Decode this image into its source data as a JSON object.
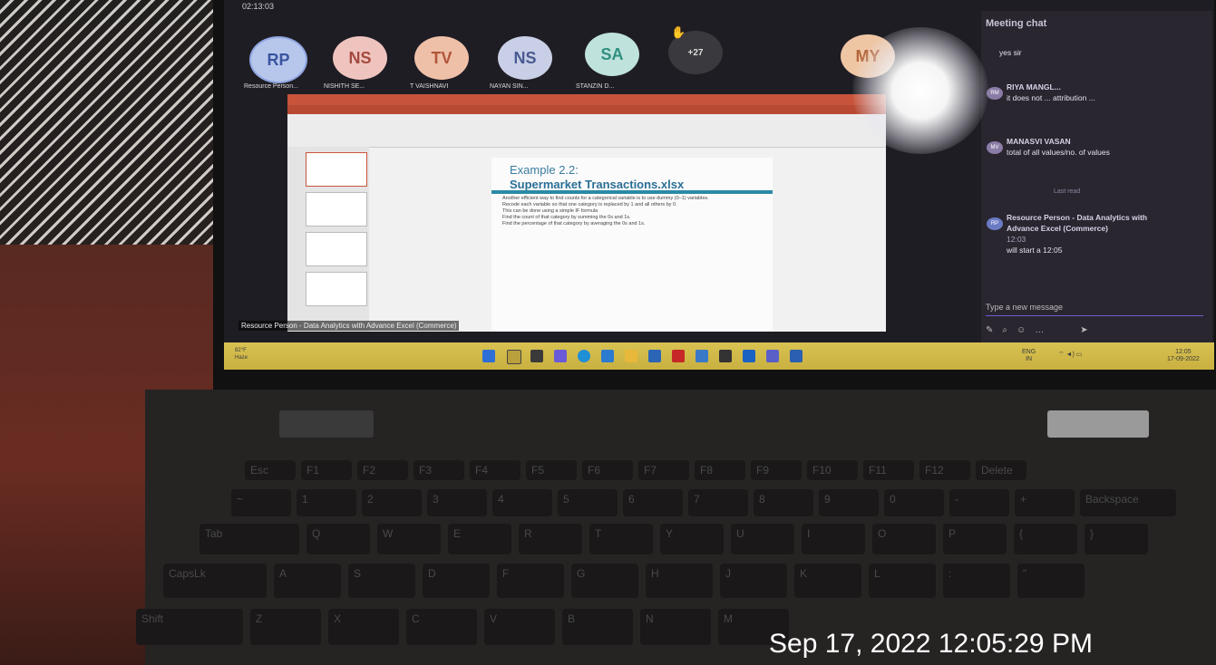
{
  "call": {
    "timer": "02:13:03",
    "participants": [
      {
        "initials": "RP",
        "name": "Resource Person...",
        "color": "#b7c7ec"
      },
      {
        "initials": "NS",
        "name": "NISHITH SE...",
        "color": "#efc4bf"
      },
      {
        "initials": "TV",
        "name": "T VAISHNAVI",
        "color": "#efc0a8"
      },
      {
        "initials": "NS",
        "name": "NAYAN SIN...",
        "color": "#c9cfe6"
      },
      {
        "initials": "SA",
        "name": "STANZIN D...",
        "color": "#bfe3dc"
      }
    ],
    "overflow": "+27",
    "extra": {
      "initials": "MY",
      "color": "#efc6a4"
    }
  },
  "shared_screen": {
    "slide_heading": "Example 2.2:",
    "slide_title": "Supermarket Transactions.xlsx",
    "slide_lines": [
      "Another efficient way to find counts for a categorical variable is to use dummy (0–1) variables.",
      "Recode each variable so that one category is replaced by 1 and all others by 0.",
      "This can be done using a simple IF formula",
      "Find the count of that category by summing the 0s and 1s.",
      "Find the percentage of that category by averaging the 0s and 1s."
    ],
    "presenter_label": "Resource Person - Data Analytics with Advance Excel (Commerce)"
  },
  "chat": {
    "title": "Meeting chat",
    "messages": [
      {
        "avatar": "",
        "sender": "",
        "text": "yes sir"
      },
      {
        "avatar": "RM",
        "sender": "RIYA MANGL...",
        "text": "it does not ... attribution ..."
      },
      {
        "avatar": "MV",
        "sender": "MANASVI VASAN",
        "text": "total of all values/no. of values"
      },
      {
        "avatar": "RP",
        "sender": "Resource Person - Data Analytics with Advance Excel (Commerce)",
        "time": "12:03",
        "text": "will start a 12:05"
      }
    ],
    "last_read": "Last read",
    "compose_placeholder": "Type a new message"
  },
  "taskbar": {
    "weather_temp": "82°F",
    "weather_desc": "Haze",
    "lang": "ENG",
    "region": "IN",
    "time": "12:05",
    "date": "17-09-2022",
    "app_icons": [
      "windows",
      "search",
      "taskview",
      "chat",
      "edge",
      "store",
      "explorer",
      "linkedin",
      "mcafee",
      "photos",
      "notes",
      "outlook",
      "teams",
      "word"
    ]
  },
  "keyboard": {
    "top_row": [
      "Esc",
      "F1",
      "F2",
      "F3",
      "F4",
      "F5",
      "F6",
      "F7",
      "F8",
      "F9",
      "F10",
      "F11",
      "F12",
      "Delete"
    ],
    "number_row": [
      "~",
      "1",
      "2",
      "3",
      "4",
      "5",
      "6",
      "7",
      "8",
      "9",
      "0",
      "-",
      "+",
      "Backspace"
    ],
    "row_q": [
      "Tab",
      "Q",
      "W",
      "E",
      "R",
      "T",
      "Y",
      "U",
      "I",
      "O",
      "P",
      "{",
      "}"
    ],
    "row_a": [
      "CapsLk",
      "A",
      "S",
      "D",
      "F",
      "G",
      "H",
      "J",
      "K",
      "L",
      ":",
      "\""
    ],
    "row_z": [
      "Shift",
      "Z",
      "X",
      "C",
      "V",
      "B",
      "N",
      "M"
    ]
  },
  "photo_timestamp": "Sep 17, 2022 12:05:29 PM"
}
